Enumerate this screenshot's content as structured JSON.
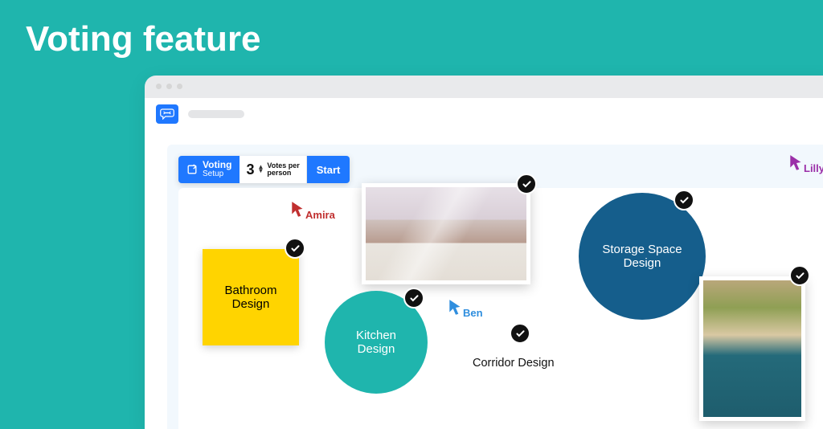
{
  "page_title": "Voting feature",
  "voting": {
    "label_top": "Voting",
    "label_bottom": "Setup",
    "count": "3",
    "per_line1": "Votes per",
    "per_line2": "person",
    "start": "Start"
  },
  "cursors": {
    "amira": {
      "name": "Amira",
      "color": "#c02f2f"
    },
    "ben": {
      "name": "Ben",
      "color": "#2f8ede"
    },
    "lilly": {
      "name": "Lilly",
      "color": "#9b2fa8"
    }
  },
  "items": {
    "bathroom": {
      "label": "Bathroom Design"
    },
    "kitchen": {
      "label": "Kitchen Design",
      "color": "#1fb5ad"
    },
    "storage": {
      "label": "Storage Space Design",
      "color": "#155e8c"
    },
    "corridor": {
      "label": "Corridor Design"
    }
  }
}
